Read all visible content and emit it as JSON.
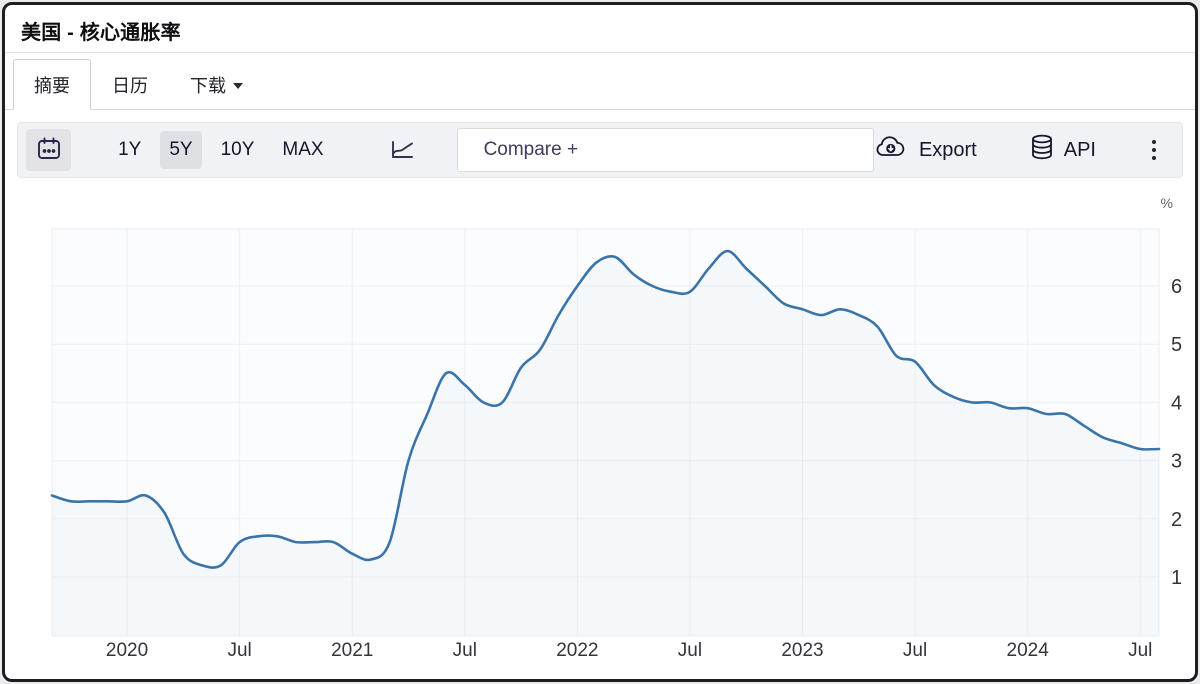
{
  "window": {
    "title": "美国 - 核心通胀率"
  },
  "tabs": [
    {
      "label": "摘要",
      "active": true
    },
    {
      "label": "日历",
      "active": false
    },
    {
      "label": "下载",
      "active": false,
      "caret": true
    }
  ],
  "toolbar": {
    "calendar_icon": "calendar-icon",
    "ranges": [
      "1Y",
      "5Y",
      "10Y",
      "MAX"
    ],
    "active_range": "5Y",
    "chart_type_icon": "line-chart-icon",
    "compare_placeholder": "Compare +",
    "export_label": "Export",
    "export_icon": "cloud-download-icon",
    "api_label": "API",
    "api_icon": "database-icon",
    "menu_icon": "kebab-menu-icon"
  },
  "chart_data": {
    "type": "line",
    "title": "美国 - 核心通胀率",
    "unit_label": "%",
    "line_color": "#3a74a8",
    "area_fill": "rgba(58,116,168,0.03)",
    "plot_bg": "#fbfcfe",
    "grid_color": "#edf0f6",
    "plot_border_color": "#e8ecf3",
    "tick_text_color": "#33343c",
    "grid": true,
    "legend": false,
    "ylim": [
      0,
      7
    ],
    "y_ticks": [
      1,
      2,
      3,
      4,
      5,
      6
    ],
    "x_tick_labels": [
      "2020",
      "Jul",
      "2021",
      "Jul",
      "2022",
      "Jul",
      "2023",
      "Jul",
      "2024",
      "Jul"
    ],
    "x": [
      "2019-09",
      "2019-10",
      "2019-11",
      "2019-12",
      "2020-01",
      "2020-02",
      "2020-03",
      "2020-04",
      "2020-05",
      "2020-06",
      "2020-07",
      "2020-08",
      "2020-09",
      "2020-10",
      "2020-11",
      "2020-12",
      "2021-01",
      "2021-02",
      "2021-03",
      "2021-04",
      "2021-05",
      "2021-06",
      "2021-07",
      "2021-08",
      "2021-09",
      "2021-10",
      "2021-11",
      "2021-12",
      "2022-01",
      "2022-02",
      "2022-03",
      "2022-04",
      "2022-05",
      "2022-06",
      "2022-07",
      "2022-08",
      "2022-09",
      "2022-10",
      "2022-11",
      "2022-12",
      "2023-01",
      "2023-02",
      "2023-03",
      "2023-04",
      "2023-05",
      "2023-06",
      "2023-07",
      "2023-08",
      "2023-09",
      "2023-10",
      "2023-11",
      "2023-12",
      "2024-01",
      "2024-02",
      "2024-03",
      "2024-04",
      "2024-05",
      "2024-06",
      "2024-07",
      "2024-08"
    ],
    "values": [
      2.4,
      2.3,
      2.3,
      2.3,
      2.3,
      2.4,
      2.1,
      1.4,
      1.2,
      1.2,
      1.6,
      1.7,
      1.7,
      1.6,
      1.6,
      1.6,
      1.4,
      1.3,
      1.6,
      3.0,
      3.8,
      4.5,
      4.3,
      4.0,
      4.0,
      4.6,
      4.9,
      5.5,
      6.0,
      6.4,
      6.5,
      6.2,
      6.0,
      5.9,
      5.9,
      6.3,
      6.6,
      6.3,
      6.0,
      5.7,
      5.6,
      5.5,
      5.6,
      5.5,
      5.3,
      4.8,
      4.7,
      4.3,
      4.1,
      4.0,
      4.0,
      3.9,
      3.9,
      3.8,
      3.8,
      3.6,
      3.4,
      3.3,
      3.2,
      3.2
    ]
  }
}
